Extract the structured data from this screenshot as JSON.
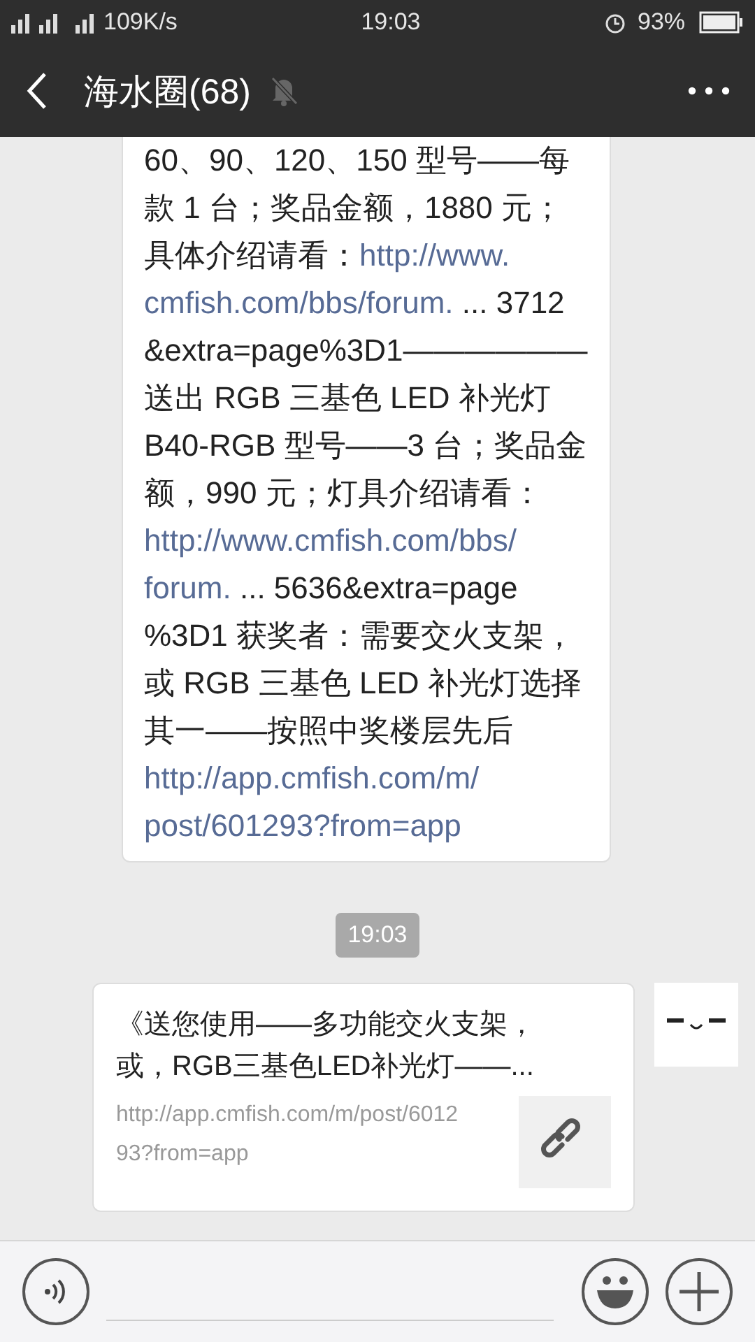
{
  "status_bar": {
    "network": "109K/s",
    "time": "19:03",
    "battery": "93%"
  },
  "header": {
    "title": "海水圈(68)",
    "muted": true
  },
  "messages": [
    {
      "kind": "text",
      "lines": [
        [
          {
            "kind": "text",
            "text": "60、90、120、150 型号——每"
          }
        ],
        [
          {
            "kind": "text",
            "text": "款 1 台；奖品金额，1880 元；"
          }
        ],
        [
          {
            "kind": "text",
            "text": "具体介绍请看："
          },
          {
            "kind": "link",
            "text": "http://www."
          }
        ],
        [
          {
            "kind": "link",
            "text": "cmfish.com/bbs/forum."
          },
          {
            "kind": "text",
            "text": " ... 3712"
          }
        ],
        [
          {
            "kind": "text",
            "text": "&extra=page%3D1——————"
          }
        ],
        [
          {
            "kind": "text",
            "text": "送出 RGB 三基色 LED 补光灯"
          }
        ],
        [
          {
            "kind": "text",
            "text": "B40-RGB 型号——3 台；奖品金"
          }
        ],
        [
          {
            "kind": "text",
            "text": "额，990 元；灯具介绍请看："
          }
        ],
        [
          {
            "kind": "link",
            "text": "http://www.cmfish.com/bbs/"
          }
        ],
        [
          {
            "kind": "link",
            "text": "forum."
          },
          {
            "kind": "text",
            "text": " ... 5636&extra=page"
          }
        ],
        [
          {
            "kind": "text",
            "text": "%3D1 获奖者：需要交火支架，"
          }
        ],
        [
          {
            "kind": "text",
            "text": "或 RGB 三基色 LED 补光灯选择"
          }
        ],
        [
          {
            "kind": "text",
            "text": "其一——按照中奖楼层先后"
          }
        ],
        [
          {
            "kind": "link",
            "text": "http://app.cmfish.com/m/"
          }
        ],
        [
          {
            "kind": "link",
            "text": "post/601293?from=app"
          }
        ]
      ]
    },
    {
      "kind": "time",
      "text": "19:03"
    },
    {
      "kind": "link_card",
      "title": "《送您使用——多功能交火支架，或，RGB三基色LED补光灯——...",
      "url": "http://app.cmfish.com/m/post/601293?from=app"
    }
  ]
}
